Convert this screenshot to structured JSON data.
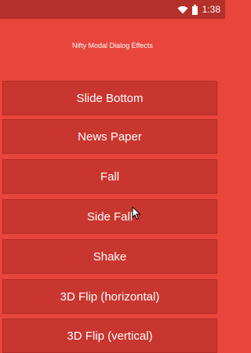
{
  "status_bar": {
    "time": "1:38",
    "icons": [
      "wifi-icon",
      "battery-icon"
    ],
    "background": "#b3312a"
  },
  "header": {
    "title": "Nifty Modal Dialog Effects"
  },
  "buttons": [
    {
      "label": "Slide Bottom"
    },
    {
      "label": "News Paper"
    },
    {
      "label": "Fall"
    },
    {
      "label": "Side Fall"
    },
    {
      "label": "Shake"
    },
    {
      "label": "3D Flip (horizontal)"
    },
    {
      "label": "3D Flip (vertical)"
    }
  ],
  "colors": {
    "background": "#e8453c",
    "button": "#c9362f",
    "text": "#ffffff"
  }
}
